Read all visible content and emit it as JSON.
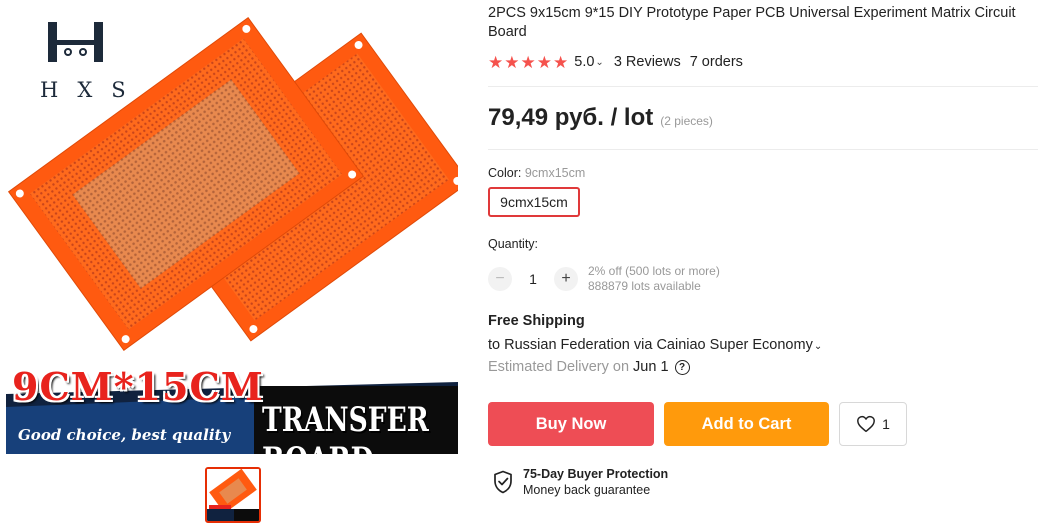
{
  "product": {
    "title": "2PCS 9x15cm 9*15 DIY Prototype Paper PCB Universal Experiment Matrix Circuit Board",
    "rating": "5.0",
    "stars": 5,
    "reviews": "3 Reviews",
    "orders": "7 orders"
  },
  "gallery": {
    "logo_text": "HXS",
    "banner_title": "9CM*15CM",
    "banner_tagline": "Good choice, best quality",
    "banner_label": "TRANSFER BOARD"
  },
  "price": {
    "amount": "79,49 руб. / lot",
    "unit_note": "(2 pieces)"
  },
  "sku": {
    "label": "Color:",
    "selected_value": "9cmx15cm",
    "option_label": "9cmx15cm"
  },
  "quantity": {
    "label": "Quantity:",
    "minus": "−",
    "value": "1",
    "plus": "+",
    "discount_note": "2% off (500 lots or more)",
    "available_note": "888879 lots available"
  },
  "shipping": {
    "title": "Free Shipping",
    "route": "to Russian Federation via Cainiao Super Economy",
    "estimate_label": "Estimated Delivery on",
    "estimate_date": "Jun 1"
  },
  "actions": {
    "buy_now": "Buy Now",
    "add_to_cart": "Add to Cart",
    "wishlist_count": "1"
  },
  "protection": {
    "title": "75-Day Buyer Protection",
    "subtitle": "Money back guarantee"
  },
  "colors": {
    "accent_red": "#ee4d55",
    "cart_orange": "#ff9a0c",
    "star_red": "#f5524d",
    "pcb_orange": "#ff5a10"
  },
  "icons": {
    "chevron": "chevron-down-icon",
    "help": "question-circle-icon",
    "wishlist": "heart-icon",
    "protection": "shield-check-icon"
  }
}
